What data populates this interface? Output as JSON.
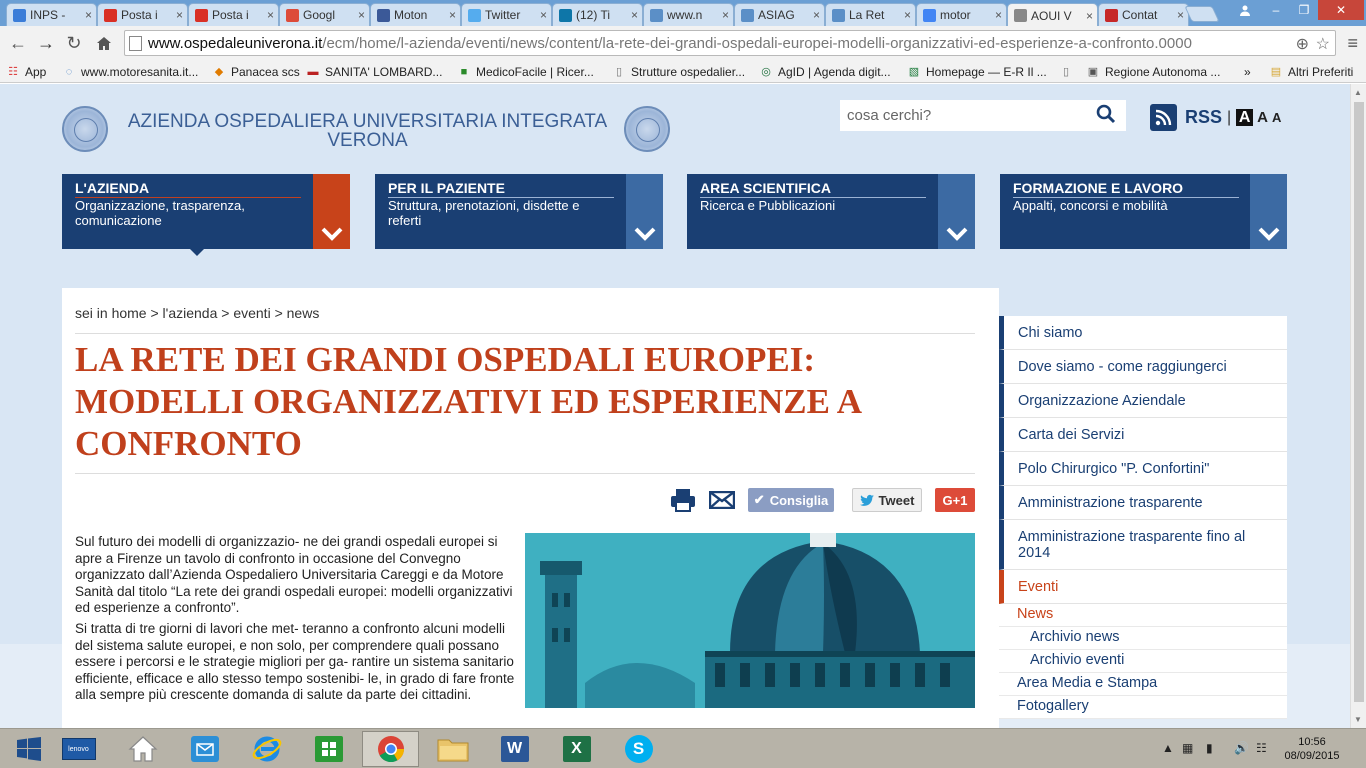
{
  "browser": {
    "tabs": [
      {
        "label": "INPS -",
        "fav_color": "#3b7dd8"
      },
      {
        "label": "Posta i",
        "fav_color": "#d93025"
      },
      {
        "label": "Posta i",
        "fav_color": "#d93025"
      },
      {
        "label": "Googl",
        "fav_color": "#dd4b39"
      },
      {
        "label": "Moton",
        "fav_color": "#3b5998"
      },
      {
        "label": "Twitter",
        "fav_color": "#55acee"
      },
      {
        "label": "(12) Ti",
        "fav_color": "#0e76a8"
      },
      {
        "label": "www.n",
        "fav_color": "#5b8fc7"
      },
      {
        "label": "ASIAG",
        "fav_color": "#5b8fc7"
      },
      {
        "label": "La Ret",
        "fav_color": "#5b8fc7"
      },
      {
        "label": "motor",
        "fav_color": "#4285f4"
      },
      {
        "label": "AOUI V",
        "fav_color": "#888888"
      },
      {
        "label": "Contat",
        "fav_color": "#c62828"
      }
    ],
    "active_tab_index": 11,
    "url_host": "www.ospedaleuniverona.it",
    "url_path": "/ecm/home/l-azienda/eventi/news/content/la-rete-dei-grandi-ospedali-europei-modelli-organizzativi-ed-esperienze-a-confronto.0000",
    "bookmarks": [
      {
        "label": "App",
        "icon": "apps-icon"
      },
      {
        "label": "www.motoresanita.it...",
        "icon": "site-icon"
      },
      {
        "label": "Panacea scs",
        "icon": "panacea-icon"
      },
      {
        "label": "SANITA' LOMBARD...",
        "icon": "lombardia-icon"
      },
      {
        "label": "MedicoFacile | Ricer...",
        "icon": "medicofacile-icon"
      },
      {
        "label": "Strutture ospedalier...",
        "icon": "page-icon"
      },
      {
        "label": "AgID | Agenda digit...",
        "icon": "agid-icon"
      },
      {
        "label": "Homepage — E-R Il ...",
        "icon": "er-icon"
      },
      {
        "label": "",
        "icon": "page-icon"
      },
      {
        "label": "Regione Autonoma ...",
        "icon": "regione-icon"
      },
      {
        "label": "»",
        "icon": ""
      },
      {
        "label": "Altri Preferiti",
        "icon": "folder-icon"
      }
    ]
  },
  "site": {
    "org_name_line1": "AZIENDA OSPEDALIERA UNIVERSITARIA INTEGRATA",
    "org_name_line2": "VERONA",
    "search_placeholder": "cosa cerchi?",
    "rss_label": "RSS",
    "font_sizes": [
      "A",
      "A",
      "A"
    ],
    "nav": [
      {
        "title": "L'AZIENDA",
        "subtitle": "Organizzazione, trasparenza, comunicazione"
      },
      {
        "title": "PER IL PAZIENTE",
        "subtitle": "Struttura, prenotazioni, disdette e referti"
      },
      {
        "title": "AREA SCIENTIFICA",
        "subtitle": "Ricerca e Pubblicazioni"
      },
      {
        "title": "FORMAZIONE E LAVORO",
        "subtitle": "Appalti, concorsi e mobilità"
      }
    ],
    "colors": {
      "navy": "#1a3f73",
      "accent": "#c8431a",
      "title": "#c0401c"
    }
  },
  "article": {
    "breadcrumb": "sei in home > l'azienda > eventi > news",
    "title": "LA RETE DEI GRANDI OSPEDALI EUROPEI: MODELLI ORGANIZZATIVI ED ESPERIENZE A CONFRONTO",
    "share": {
      "like": "Consiglia",
      "tweet": "Tweet",
      "gplus": "G+1"
    },
    "paragraphs": [
      "Sul futuro dei modelli di organizzazio- ne dei grandi ospedali europei si apre a Firenze un tavolo di confronto in occasione del Convegno organizzato dall’Azienda Ospedaliero Universitaria Careggi e da Motore Sanità dal titolo “La rete dei grandi ospedali europei: modelli organizzativi ed esperienze a confronto”.",
      "Si tratta di tre giorni di lavori che met- teranno a confronto alcuni modelli del sistema salute europei, e non solo, per comprendere quali possano essere i percorsi e le strategie migliori per ga- rantire un sistema sanitario efficiente, efficace e allo stesso tempo sostenibi- le, in grado di fare fronte alla sempre più crescente domanda di salute da parte dei cittadini."
    ]
  },
  "sidebar": {
    "items": [
      "Chi siamo",
      "Dove siamo - come raggiungerci",
      "Organizzazione Aziendale",
      "Carta dei Servizi",
      "Polo Chirurgico \"P. Confortini\"",
      "Amministrazione trasparente",
      "Amministrazione trasparente fino al 2014",
      "Eventi"
    ],
    "subitems": [
      {
        "label": "News",
        "style": "red"
      },
      {
        "label": "Archivio news",
        "style": "indent"
      },
      {
        "label": "Archivio eventi",
        "style": "indent"
      },
      {
        "label": "Area Media e Stampa",
        "style": ""
      },
      {
        "label": "Fotogallery",
        "style": ""
      }
    ]
  },
  "taskbar": {
    "time": "10:56",
    "date": "08/09/2015"
  }
}
